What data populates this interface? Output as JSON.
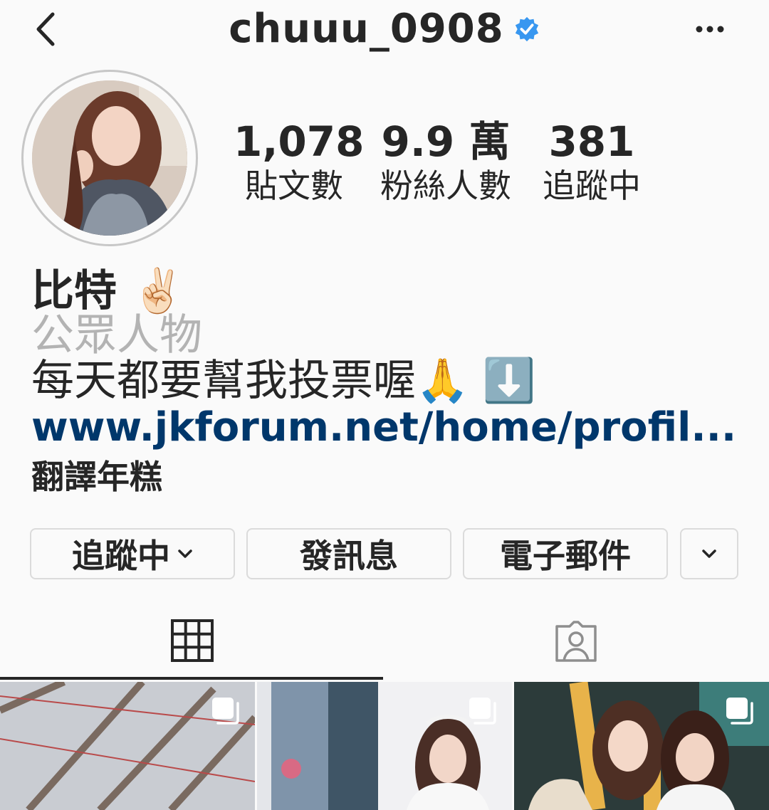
{
  "header": {
    "username": "chuuu_0908",
    "icons": {
      "back": "chevron-left-icon",
      "verified": "verified-badge-icon",
      "more": "more-horizontal-icon"
    },
    "verified_color": "#3897f0"
  },
  "stats": [
    {
      "value": "1,078",
      "label": "貼文數"
    },
    {
      "value": "9.9 萬",
      "label": "粉絲人數"
    },
    {
      "value": "381",
      "label": "追蹤中"
    }
  ],
  "bio": {
    "name": "比特 ✌🏻",
    "category": "公眾人物",
    "text": "每天都要幫我投票喔🙏 ⬇️",
    "link": "www.jkforum.net/home/profil...",
    "translate": "翻譯年糕"
  },
  "buttons": {
    "following": "追蹤中",
    "message": "發訊息",
    "email": "電子郵件"
  },
  "tabs": {
    "grid_icon": "grid-icon",
    "tagged_icon": "tagged-person-icon"
  },
  "grid": {
    "multi_icon": "multiple-photos-icon"
  },
  "colors": {
    "link": "#00376b",
    "text": "#262626",
    "muted": "#b3b3b3",
    "border": "#dbdbdb"
  }
}
